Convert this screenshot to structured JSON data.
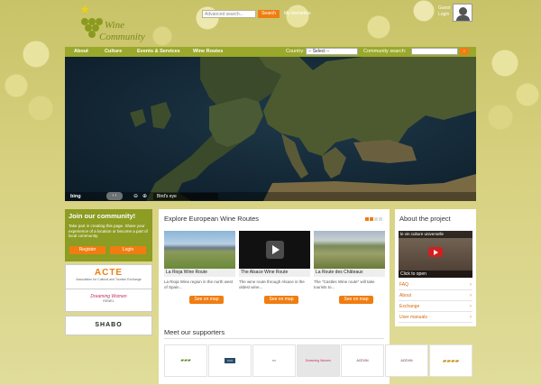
{
  "header": {
    "logo_word1": "Wine",
    "logo_word2": "Community",
    "search_placeholder": "Advanced search...",
    "search_button": "Search",
    "my_favourites": "My favourites",
    "guest": "Guest",
    "login": "Login"
  },
  "nav": {
    "items": [
      "About",
      "Culture",
      "Events & Services",
      "Wine Routes"
    ],
    "country_label": "Country:",
    "country_value": "-- Select --",
    "community_search_label": "Community search:",
    "community_search_button": "Go"
  },
  "map": {
    "bing": "bing",
    "birds_eye": "Bird's eye"
  },
  "join": {
    "title": "Join our community!",
    "text": "Take part in creating this page. Share your experience of a location or become a part of local community.",
    "register": "Register",
    "login": "Login"
  },
  "partners": [
    {
      "logo": "ACTE",
      "note": "Association for Cultural and Tourism Exchange"
    },
    {
      "logo": "Dreaming Women",
      "note": "REWEL"
    },
    {
      "logo": "SHABO",
      "note": ""
    }
  ],
  "main": {
    "title": "Explore European Wine Routes",
    "routes": [
      {
        "caption": "La Rioja Wine Route",
        "desc": "La Rioja Wine region in the north west of Spain...",
        "button": "See on map"
      },
      {
        "caption": "The Alsace Wine Route",
        "desc": "The wine route through Alsace is the oldest wine...",
        "button": "See on map"
      },
      {
        "caption": "La Route des Châteaux",
        "desc": "The \"Castles Wine route\" will take tourists to...",
        "button": "See on map"
      }
    ],
    "supporters_title": "Meet our supporters",
    "supporters": [
      "",
      "",
      "",
      "Dreaming Women",
      "ACEVIN",
      "ACEVIN",
      ""
    ]
  },
  "about": {
    "title": "About the project",
    "video_title": "le vin culture universelle",
    "video_cta": "Click to open",
    "links": [
      "FAQ",
      "About",
      "Exchange",
      "User manuals"
    ]
  },
  "colors": {
    "accent": "#f07d12",
    "nav_green": "#9aa82c",
    "join_green": "#8d9c22"
  }
}
